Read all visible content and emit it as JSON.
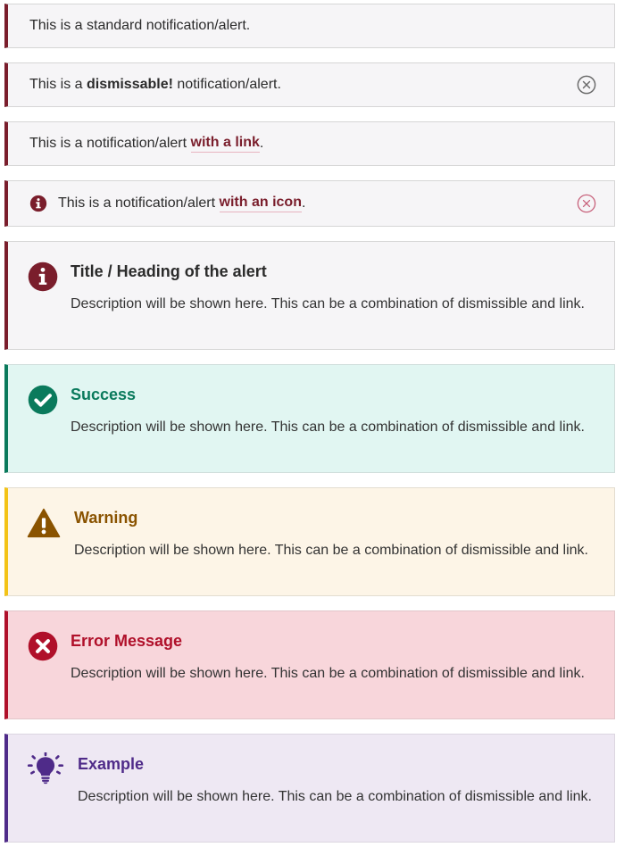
{
  "alerts": {
    "standard": {
      "text": "This is a standard notification/alert."
    },
    "dismissable": {
      "text_before": "This is a ",
      "bold": "dismissable!",
      "text_after": " notification/alert.",
      "close_icon": "circle-x-icon"
    },
    "with_link": {
      "text_before": "This is a notification/alert ",
      "link": "with a link",
      "text_after": "."
    },
    "with_icon": {
      "icon": "info-circle-icon",
      "text_before": "This is a notification/alert ",
      "link": "with an icon",
      "text_after": ".",
      "close_icon": "circle-x-icon"
    },
    "default_titled": {
      "icon": "info-circle-icon",
      "title": "Title / Heading of the alert",
      "description": "Description will be shown here. This can be a combination of dismissible and link."
    },
    "success": {
      "icon": "check-circle-icon",
      "title": "Success",
      "description": "Description will be shown here. This can be a combination of dismissible and link."
    },
    "warning": {
      "icon": "warning-triangle-icon",
      "title": "Warning",
      "description": "Description will be shown here. This can be a combination of dismissible and link."
    },
    "error": {
      "icon": "x-circle-icon",
      "title": "Error Message",
      "description": "Description will be shown here. This can be a combination of dismissible and link."
    },
    "example": {
      "icon": "lightbulb-icon",
      "title": "Example",
      "description": "Description will be shown here. This can be a combination of dismissible and link."
    }
  },
  "colors": {
    "default": "#7a1e2c",
    "success": "#0a7a5c",
    "warning": "#8a5300",
    "warning_bar": "#f3c317",
    "error": "#b0102a",
    "example": "#4f2b89",
    "close_default": "#6a6a6a",
    "close_pink": "#c7607a"
  }
}
